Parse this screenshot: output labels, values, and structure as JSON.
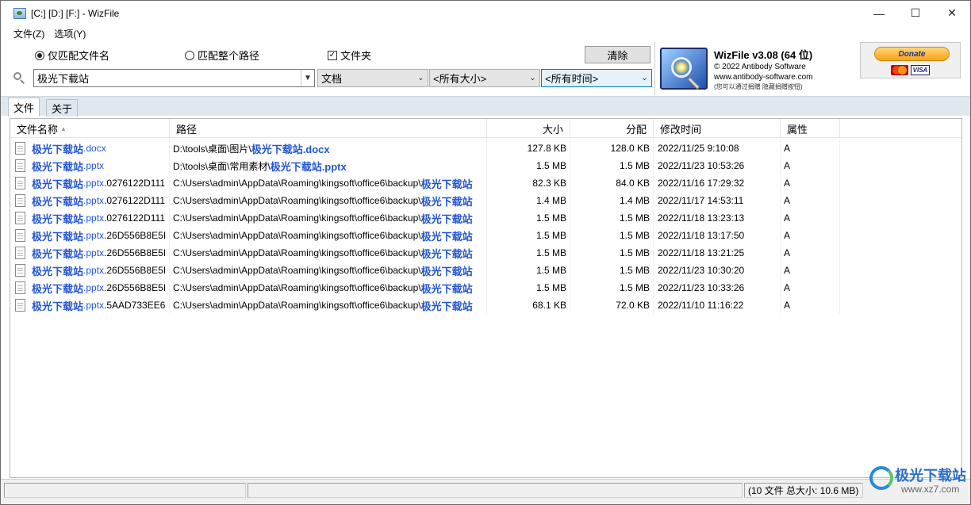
{
  "window": {
    "title": "[C:] [D:] [F:]  - WizFile",
    "minimize": "—",
    "maximize": "☐",
    "close": "✕"
  },
  "menu": [
    "文件(Z)",
    "选项(Y)"
  ],
  "options": {
    "radio_filename": "仅匹配文件名",
    "radio_fullpath": "匹配整个路径",
    "checkbox_folders": "文件夹",
    "checkbox_checked": true,
    "clear_label": "清除"
  },
  "search": {
    "query": "极光下载站",
    "type_filter": "文档",
    "size_filter": "<所有大小>",
    "time_filter": "<所有时间>"
  },
  "about": {
    "title": "WizFile v3.08 (64 位)",
    "copyright": "© 2022 Antibody Software",
    "website": "www.antibody-software.com",
    "note": "(您可以通过捐赠 隐藏捐赠按钮)",
    "donate_label": "Donate",
    "card_visa": "VISA"
  },
  "tabs": [
    "文件",
    "关于"
  ],
  "columns": {
    "name": "文件名称",
    "path": "路径",
    "size": "大小",
    "alloc": "分配",
    "modified": "修改时间",
    "attr": "属性"
  },
  "rows": [
    {
      "name_hl": "极光下载站",
      "name_ext": ".docx",
      "name_rest": "",
      "path_pre": "D:\\tools\\桌面\\图片\\",
      "path_hl": "极光下载站.docx",
      "size": "127.8 KB",
      "alloc": "128.0 KB",
      "modified": "2022/11/25 9:10:08",
      "attr": "A"
    },
    {
      "name_hl": "极光下载站",
      "name_ext": ".pptx",
      "name_rest": "",
      "path_pre": "D:\\tools\\桌面\\常用素材\\",
      "path_hl": "极光下载站.pptx",
      "size": "1.5 MB",
      "alloc": "1.5 MB",
      "modified": "2022/11/23 10:53:26",
      "attr": "A"
    },
    {
      "name_hl": "极光下载站",
      "name_ext": ".pptx",
      "name_rest": ".0276122D111",
      "path_pre": "C:\\Users\\admin\\AppData\\Roaming\\kingsoft\\office6\\backup\\",
      "path_hl": "极光下载站",
      "size": "82.3 KB",
      "alloc": "84.0 KB",
      "modified": "2022/11/16 17:29:32",
      "attr": "A"
    },
    {
      "name_hl": "极光下载站",
      "name_ext": ".pptx",
      "name_rest": ".0276122D111",
      "path_pre": "C:\\Users\\admin\\AppData\\Roaming\\kingsoft\\office6\\backup\\",
      "path_hl": "极光下载站",
      "size": "1.4 MB",
      "alloc": "1.4 MB",
      "modified": "2022/11/17 14:53:11",
      "attr": "A"
    },
    {
      "name_hl": "极光下载站",
      "name_ext": ".pptx",
      "name_rest": ".0276122D111",
      "path_pre": "C:\\Users\\admin\\AppData\\Roaming\\kingsoft\\office6\\backup\\",
      "path_hl": "极光下载站",
      "size": "1.5 MB",
      "alloc": "1.5 MB",
      "modified": "2022/11/18 13:23:13",
      "attr": "A"
    },
    {
      "name_hl": "极光下载站",
      "name_ext": ".pptx",
      "name_rest": ".26D556B8E5I",
      "path_pre": "C:\\Users\\admin\\AppData\\Roaming\\kingsoft\\office6\\backup\\",
      "path_hl": "极光下载站",
      "size": "1.5 MB",
      "alloc": "1.5 MB",
      "modified": "2022/11/18 13:17:50",
      "attr": "A"
    },
    {
      "name_hl": "极光下载站",
      "name_ext": ".pptx",
      "name_rest": ".26D556B8E5I",
      "path_pre": "C:\\Users\\admin\\AppData\\Roaming\\kingsoft\\office6\\backup\\",
      "path_hl": "极光下载站",
      "size": "1.5 MB",
      "alloc": "1.5 MB",
      "modified": "2022/11/18 13:21:25",
      "attr": "A"
    },
    {
      "name_hl": "极光下载站",
      "name_ext": ".pptx",
      "name_rest": ".26D556B8E5I",
      "path_pre": "C:\\Users\\admin\\AppData\\Roaming\\kingsoft\\office6\\backup\\",
      "path_hl": "极光下载站",
      "size": "1.5 MB",
      "alloc": "1.5 MB",
      "modified": "2022/11/23 10:30:20",
      "attr": "A"
    },
    {
      "name_hl": "极光下载站",
      "name_ext": ".pptx",
      "name_rest": ".26D556B8E5I",
      "path_pre": "C:\\Users\\admin\\AppData\\Roaming\\kingsoft\\office6\\backup\\",
      "path_hl": "极光下载站",
      "size": "1.5 MB",
      "alloc": "1.5 MB",
      "modified": "2022/11/23 10:33:26",
      "attr": "A"
    },
    {
      "name_hl": "极光下载站",
      "name_ext": ".pptx",
      "name_rest": ".5AAD733EE6",
      "path_pre": "C:\\Users\\admin\\AppData\\Roaming\\kingsoft\\office6\\backup\\",
      "path_hl": "极光下载站",
      "size": "68.1 KB",
      "alloc": "72.0 KB",
      "modified": "2022/11/10 11:16:22",
      "attr": "A"
    }
  ],
  "status": {
    "summary": "(10 文件  总大小: 10.6 MB)"
  },
  "watermark": {
    "text": "极光下载站",
    "url": "www.xz7.com"
  },
  "colors": {
    "highlight": "#2356d4",
    "tabbar": "#dfe8ef",
    "active_combo": "#0078d7"
  }
}
